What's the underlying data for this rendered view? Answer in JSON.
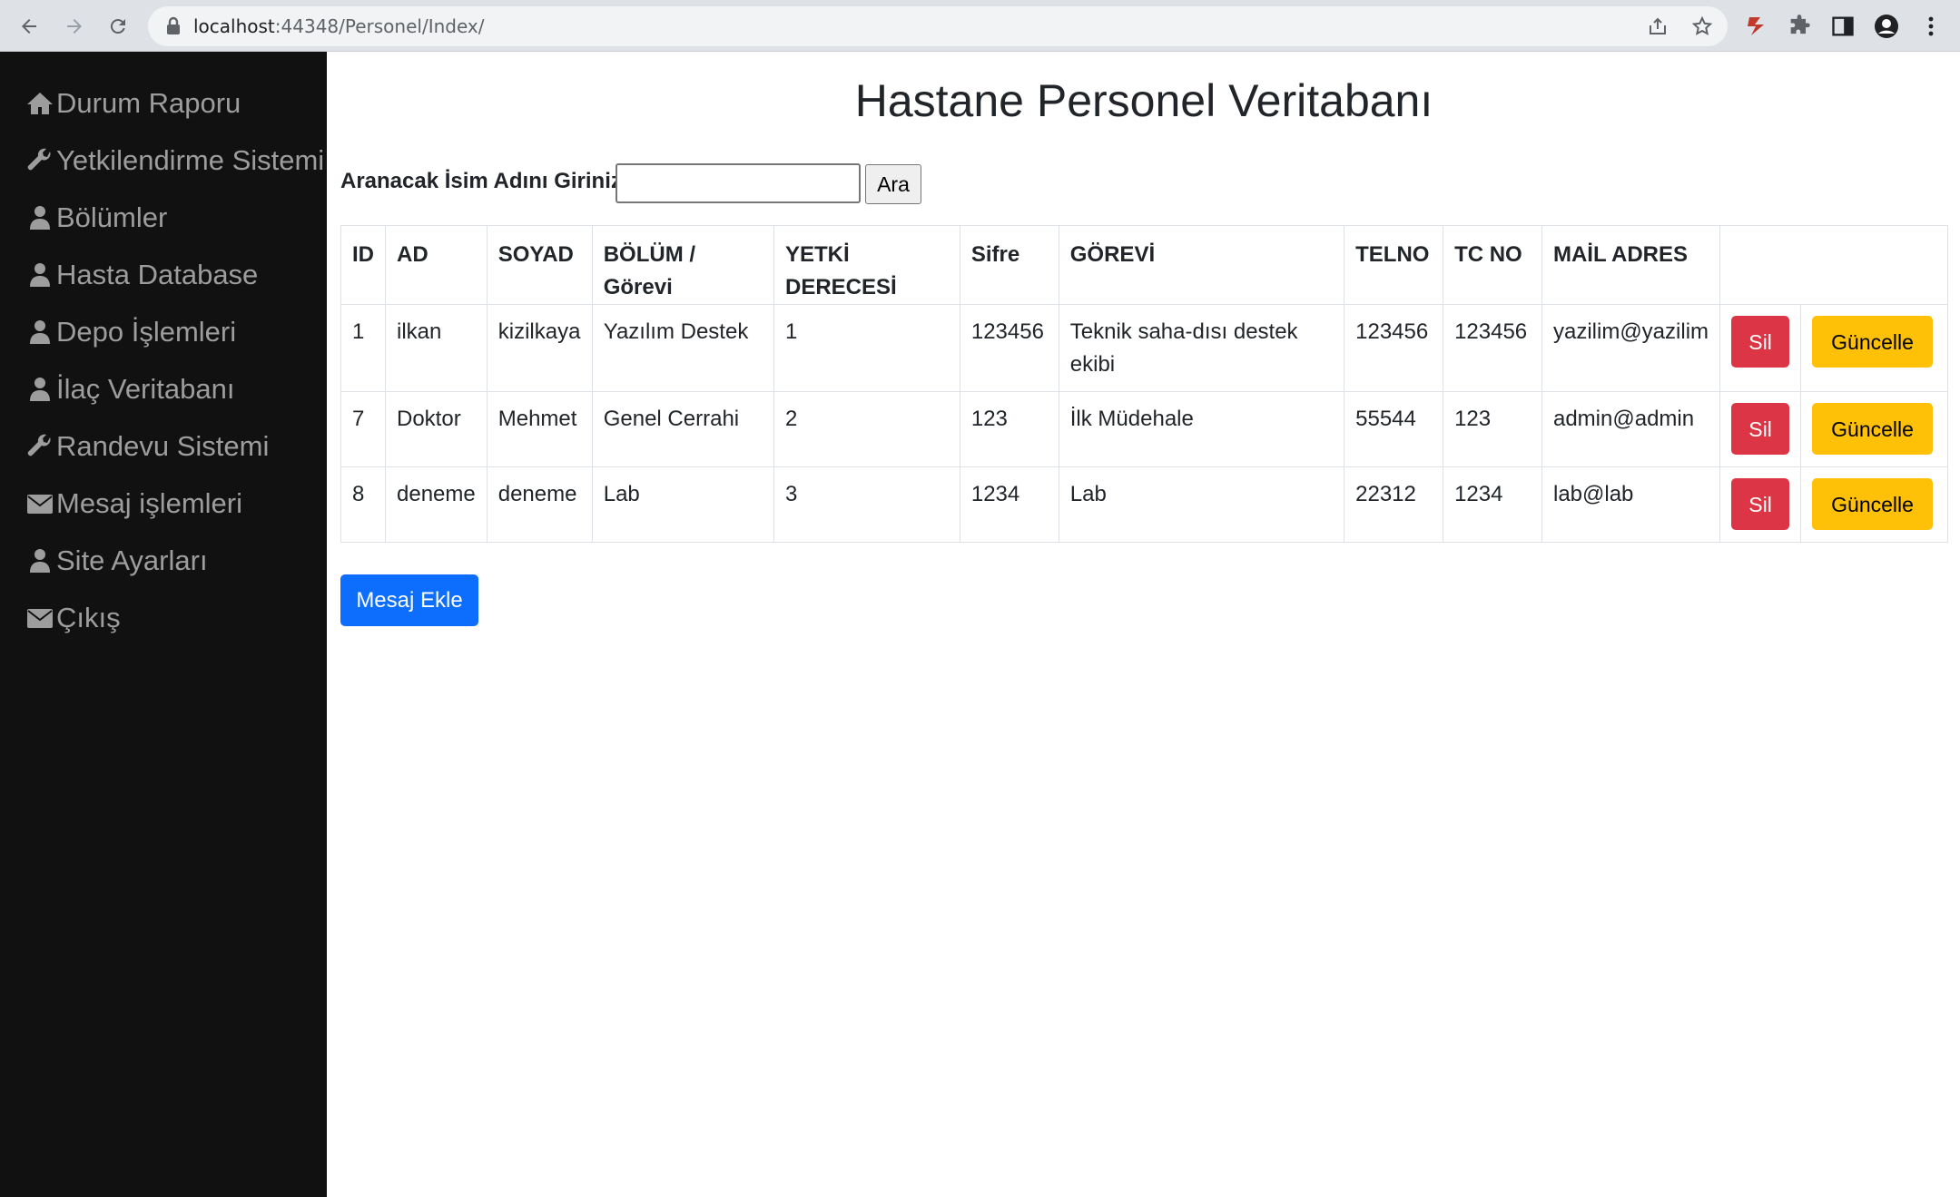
{
  "browser": {
    "url_host": "localhost",
    "url_rest": ":44348/Personel/Index/"
  },
  "sidebar": {
    "items": [
      {
        "label": "Durum Raporu",
        "icon": "home-icon"
      },
      {
        "label": "Yetkilendirme Sistemi",
        "icon": "wrench-icon"
      },
      {
        "label": "Bölümler",
        "icon": "user-icon"
      },
      {
        "label": "Hasta Database",
        "icon": "user-icon"
      },
      {
        "label": "Depo İşlemleri",
        "icon": "user-icon"
      },
      {
        "label": "İlaç Veritabanı",
        "icon": "user-icon"
      },
      {
        "label": "Randevu Sistemi",
        "icon": "wrench-icon"
      },
      {
        "label": "Mesaj işlemleri",
        "icon": "envelope-icon"
      },
      {
        "label": "Site Ayarları",
        "icon": "user-icon"
      },
      {
        "label": "Çıkış",
        "icon": "envelope-icon"
      }
    ]
  },
  "main": {
    "title": "Hastane Personel Veritabanı",
    "search_label": "Aranacak İsim Adını Giriniz!",
    "search_value": "",
    "search_button": "Ara",
    "add_button": "Mesaj Ekle"
  },
  "table": {
    "headers": [
      "ID",
      "AD",
      "SOYAD",
      "BÖLÜM / Görevi",
      "YETKİ DERECESİ",
      "Sifre",
      "GÖREVİ",
      "TELNO",
      "TC NO",
      "MAİL ADRES"
    ],
    "rows": [
      [
        "1",
        "ilkan",
        "kizilkaya",
        "Yazılım Destek",
        "1",
        "123456",
        "Teknik saha-dısı destek ekibi",
        "123456",
        "123456",
        "yazilim@yazilim"
      ],
      [
        "7",
        "Doktor",
        "Mehmet",
        "Genel Cerrahi",
        "2",
        "123",
        "İlk Müdehale",
        "55544",
        "123",
        "admin@admin"
      ],
      [
        "8",
        "deneme",
        "deneme",
        "Lab",
        "3",
        "1234",
        "Lab",
        "22312",
        "1234",
        "lab@lab"
      ]
    ],
    "delete_label": "Sil",
    "update_label": "Güncelle"
  },
  "colors": {
    "sidebar_bg": "#111111",
    "sidebar_text": "#9d9d9d",
    "danger": "#dc3545",
    "warning": "#ffc107",
    "primary": "#0d6efd"
  }
}
